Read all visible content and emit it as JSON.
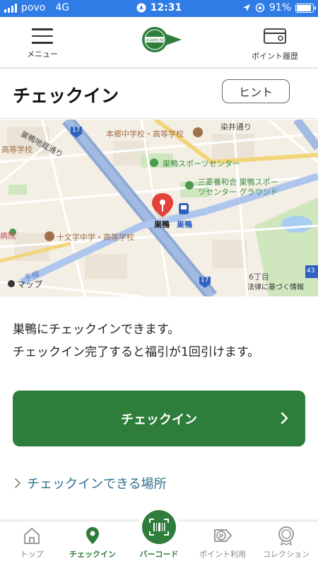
{
  "status_bar": {
    "carrier": "povo",
    "network": "4G",
    "time": "12:31",
    "battery": "91%",
    "battery_level": 0.91
  },
  "header": {
    "menu_label": "メニュー",
    "logo_text": "SUGAMO.NET",
    "points_history_label": "ポイント履歴"
  },
  "page": {
    "title": "チェックイン",
    "hint_button": "ヒント"
  },
  "map": {
    "labels": {
      "road_sugamo_jizo": "巣鴨地蔵通り",
      "school_hongo": "本郷中学校・高等学校",
      "road_somei": "染井通り",
      "school_left": "高等学校",
      "sports_center": "巣鴨スポーツセンター",
      "mitsubishi_line1": "三菱養和会 巣鴨スポー",
      "mitsubishi_line2": "ツセンター グラウンド",
      "station_pin": "巣鴨",
      "station_label": "巣鴨",
      "hospital": "病院",
      "school_jumonji": "十文字中学・高等学校",
      "attribution": "マップ",
      "area_6chome": "6丁目",
      "legal": "法律に基づく情報",
      "route_17_a": "17",
      "route_17_b": "17",
      "route_43": "43",
      "line_label": "手線"
    }
  },
  "content": {
    "description_line1": "巣鴨にチェックインできます。",
    "description_line2": "チェックイン完了すると福引が1回引けます。",
    "checkin_button": "チェックイン",
    "places_link": "チェックインできる場所"
  },
  "tab_bar": {
    "items": [
      {
        "label": "トップ",
        "icon": "home-icon"
      },
      {
        "label": "チェックイン",
        "icon": "location-pin-icon",
        "active": true
      },
      {
        "label": "バーコード",
        "icon": "barcode-icon"
      },
      {
        "label": "ポイント利用",
        "icon": "point-tag-icon"
      },
      {
        "label": "コレクション",
        "icon": "medal-icon"
      }
    ]
  },
  "colors": {
    "status_bar": "#2f7ce6",
    "brand_green": "#2e7d3b",
    "link_blue": "#2e6f8e"
  }
}
